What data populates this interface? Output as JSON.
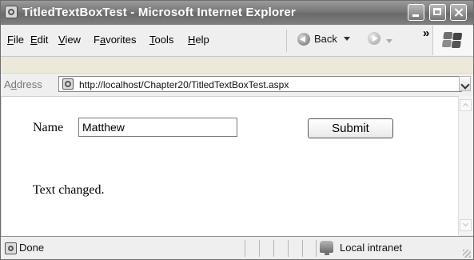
{
  "window": {
    "title": "TitledTextBoxTest - Microsoft Internet Explorer"
  },
  "menu": {
    "items": [
      {
        "label": "File",
        "mnemonic": "F",
        "rest": "ile"
      },
      {
        "label": "Edit",
        "mnemonic": "E",
        "rest": "dit"
      },
      {
        "label": "View",
        "mnemonic": "V",
        "rest": "iew"
      },
      {
        "label": "Favorites",
        "prefix": "F",
        "mnemonic": "a",
        "rest": "vorites"
      },
      {
        "label": "Tools",
        "mnemonic": "T",
        "rest": "ools"
      },
      {
        "label": "Help",
        "mnemonic": "H",
        "rest": "elp"
      }
    ]
  },
  "toolbar": {
    "back_label": "Back",
    "chevron": "»",
    "icons": [
      "back-icon",
      "forward-icon",
      "windows-logo-icon"
    ]
  },
  "address": {
    "label_prefix": "A",
    "label_mnemonic": "d",
    "label_rest": "dress",
    "url": "http://localhost/Chapter20/TitledTextBoxTest.aspx",
    "icon": "page-icon"
  },
  "form": {
    "name_label": "Name",
    "name_value": "Matthew",
    "submit_label": "Submit",
    "message": "Text changed."
  },
  "status": {
    "text": "Done",
    "zone": "Local intranet",
    "icons": [
      "page-icon",
      "intranet-icon"
    ]
  },
  "colors": {
    "window_border": "#6d6d6d",
    "titlebar": "#777777",
    "toolbar": "#efefef",
    "content": "#ffffff"
  }
}
